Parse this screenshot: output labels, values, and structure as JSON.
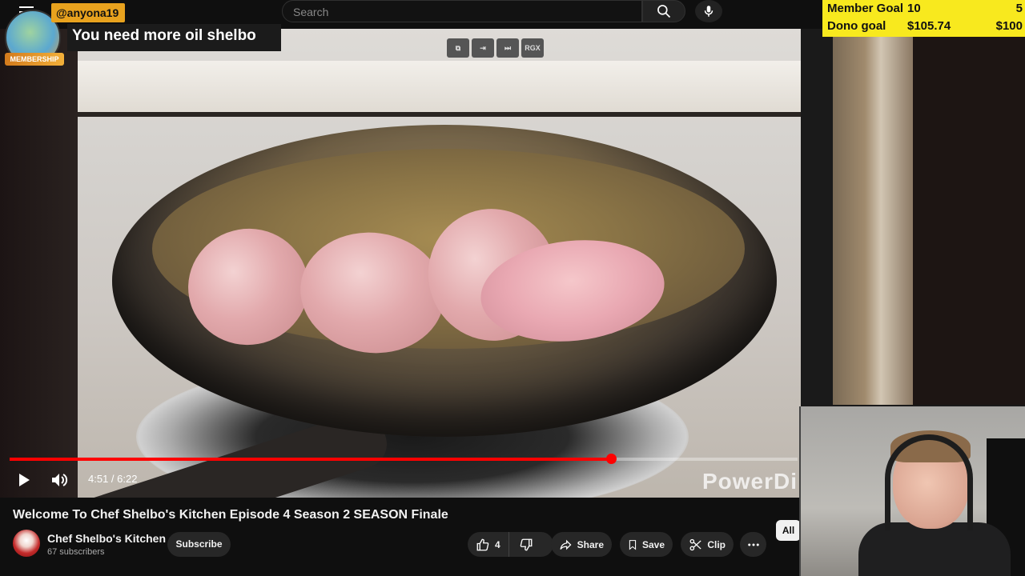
{
  "header": {
    "search_placeholder": "Search"
  },
  "chat_overlay": {
    "username": "@anyona19",
    "message": "You need more oil shelbo",
    "badge": "MEMBERSHIP"
  },
  "mini_controls": [
    "RGX"
  ],
  "goals": {
    "member_label": "Member Goal",
    "member_value": "10",
    "member_target": "5",
    "dono_label": "Dono goal",
    "dono_value": "$105.74",
    "dono_target": "$100"
  },
  "video": {
    "watermark": "PowerDi",
    "current_time": "4:51",
    "duration": "6:22",
    "time_display": "4:51 / 6:22",
    "progress_fraction": 0.7631
  },
  "video_info": {
    "title": "Welcome To Chef Shelbo's Kitchen Episode 4 Season 2 SEASON Finale",
    "channel_name": "Chef Shelbo's Kitchen",
    "subscribers": "67 subscribers",
    "subscribe_label": "Subscribe",
    "like_count": "4",
    "share_label": "Share",
    "save_label": "Save",
    "clip_label": "Clip",
    "filter_all": "All"
  },
  "colors": {
    "goal_bg": "#f8e91e",
    "chat_name_bg": "#e8a21e",
    "progress": "#ff0000"
  }
}
